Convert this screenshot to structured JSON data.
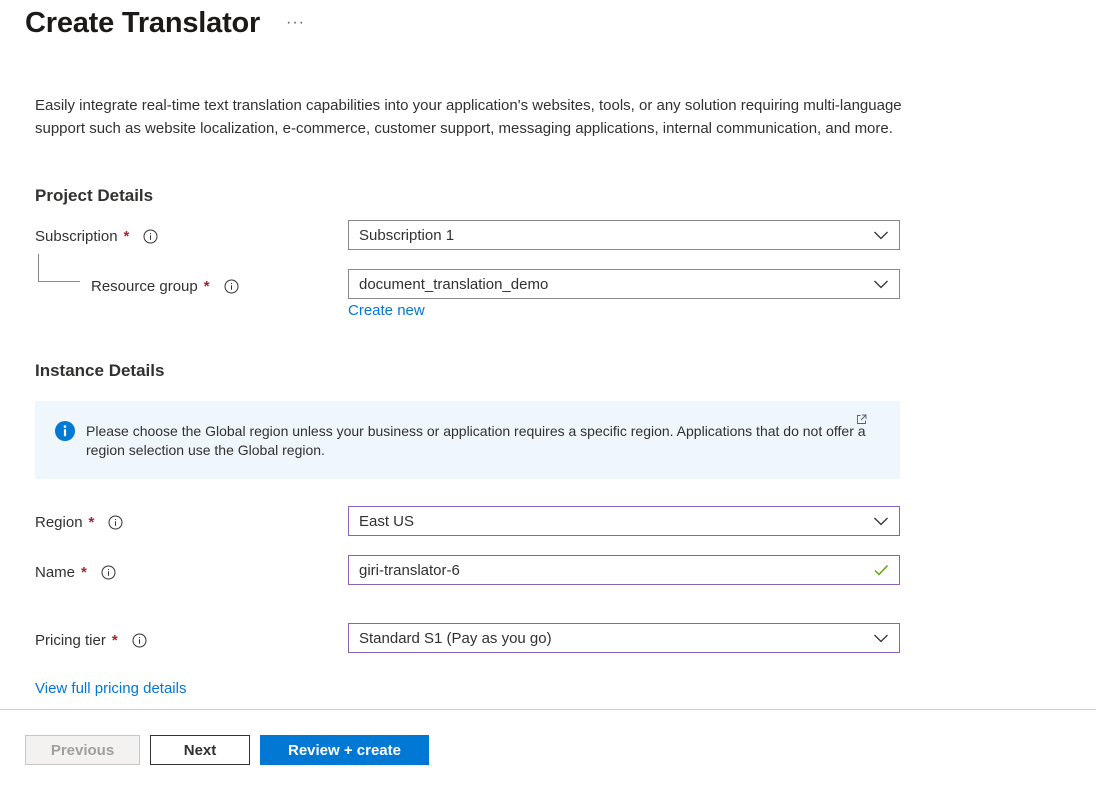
{
  "header": {
    "title": "Create Translator",
    "more_label": "···"
  },
  "description": "Easily integrate real-time text translation capabilities into your application's websites, tools, or any solution requiring multi-language support such as website localization, e-commerce, customer support, messaging applications, internal communication, and more.",
  "project_details": {
    "heading": "Project Details",
    "subscription": {
      "label": "Subscription",
      "required": "*",
      "value": "Subscription 1"
    },
    "resource_group": {
      "label": "Resource group",
      "required": "*",
      "value": "document_translation_demo",
      "create_new": "Create new"
    }
  },
  "instance_details": {
    "heading": "Instance Details",
    "info_message": "Please choose the Global region unless your business or application requires a specific region. Applications that do not offer a region selection use the Global region.",
    "region": {
      "label": "Region",
      "required": "*",
      "value": "East US"
    },
    "name": {
      "label": "Name",
      "required": "*",
      "value": "giri-translator-6"
    },
    "pricing_tier": {
      "label": "Pricing tier",
      "required": "*",
      "value": "Standard S1 (Pay as you go)"
    },
    "pricing_link": "View full pricing details"
  },
  "footer": {
    "previous": "Previous",
    "next": "Next",
    "review_create": "Review + create"
  },
  "icons": {
    "info": "info-icon",
    "chevron": "chevron-down-icon",
    "check": "check-icon",
    "external": "external-link-icon"
  },
  "colors": {
    "accent": "#0078d4",
    "required": "#a4262c",
    "valid": "#57a300",
    "focus_border": "#8764b8",
    "info_bg": "#eff6fc"
  }
}
